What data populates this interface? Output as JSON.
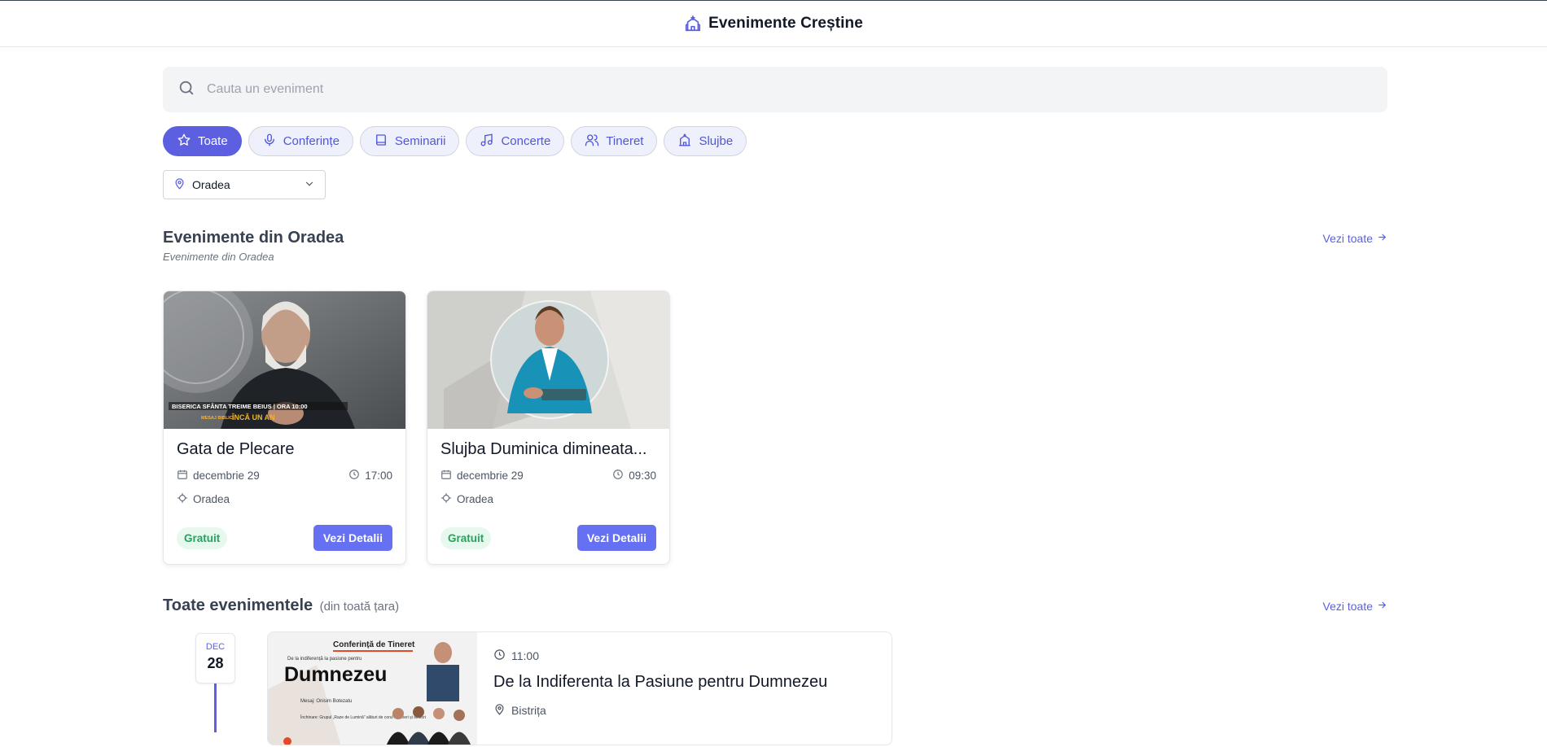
{
  "header": {
    "title": "Evenimente Creștine",
    "icon": "church-icon"
  },
  "search": {
    "placeholder": "Cauta un eveniment"
  },
  "categories": [
    {
      "label": "Toate",
      "icon": "star-icon",
      "active": true
    },
    {
      "label": "Conferințe",
      "icon": "microphone-icon",
      "active": false
    },
    {
      "label": "Seminarii",
      "icon": "book-icon",
      "active": false
    },
    {
      "label": "Concerte",
      "icon": "music-note-icon",
      "active": false
    },
    {
      "label": "Tineret",
      "icon": "users-icon",
      "active": false
    },
    {
      "label": "Slujbe",
      "icon": "church-icon",
      "active": false
    }
  ],
  "city_select": {
    "value": "Oradea"
  },
  "local_section": {
    "title": "Evenimente din Oradea",
    "subtitle": "Evenimente din Oradea",
    "see_all": "Vezi toate",
    "events": [
      {
        "title": "Gata de Plecare",
        "date": "decembrie 29",
        "time": "17:00",
        "location": "Oradea",
        "price": "Gratuit",
        "button": "Vezi Detalii",
        "image_caption_1": "BISERICA SFÂNTA TREIME BEIUS | ORA 10:00",
        "image_caption_2": "MESAJ BIBLIC:",
        "image_caption_3": "ÎNCĂ UN AN"
      },
      {
        "title": "Slujba Duminica dimineata...",
        "date": "decembrie 29",
        "time": "09:30",
        "location": "Oradea",
        "price": "Gratuit",
        "button": "Vezi Detalii"
      }
    ]
  },
  "all_section": {
    "title": "Toate evenimentele",
    "subtitle": "(din toată țara)",
    "see_all": "Vezi toate",
    "events": [
      {
        "month": "DEC",
        "day": "28",
        "time": "11:00",
        "title": "De la Indiferenta la Pasiune pentru Dumnezeu",
        "location": "Bistrița",
        "poster_heading": "Conferință de Tineret",
        "poster_subheading": "De la indiferență la pasiune pentru",
        "poster_main": "Dumnezeu",
        "poster_line_1": "Mesaj: Onisim Botezatu",
        "poster_line_2": "Închinare: Grupul „Raze de Lumină” alături de corul de tineri și seniori"
      }
    ]
  }
}
